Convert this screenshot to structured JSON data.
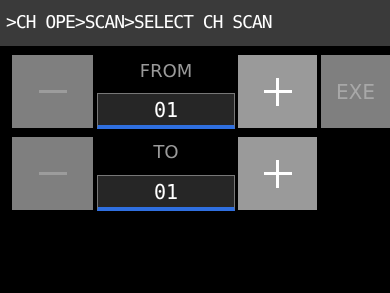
{
  "header": {
    "path": ">CH OPE>SCAN>SELECT CH SCAN"
  },
  "from": {
    "label": "FROM",
    "value": "01"
  },
  "to": {
    "label": "TO",
    "value": "01"
  },
  "buttons": {
    "exe_label": "EXE"
  },
  "icons": {
    "minus": "minus-icon",
    "plus": "plus-icon"
  }
}
